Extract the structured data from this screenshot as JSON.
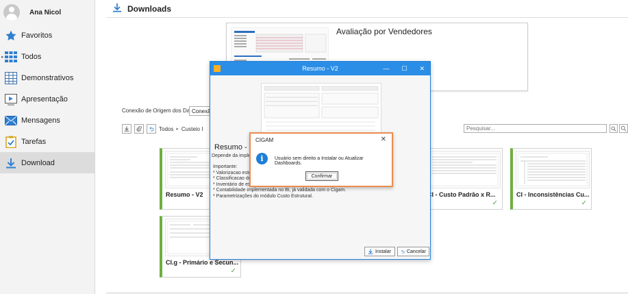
{
  "sidebar": {
    "user_name": "Ana Nicol",
    "items": [
      {
        "label": "Favoritos",
        "icon": "star-icon"
      },
      {
        "label": "Todos",
        "icon": "grid-icon"
      },
      {
        "label": "Demonstrativos",
        "icon": "table-icon"
      },
      {
        "label": "Apresentação",
        "icon": "presentation-icon"
      },
      {
        "label": "Mensagens",
        "icon": "mail-icon"
      },
      {
        "label": "Tarefas",
        "icon": "clipboard-icon"
      },
      {
        "label": "Download",
        "icon": "download-icon"
      }
    ]
  },
  "header": {
    "title": "Downloads"
  },
  "report_preview": {
    "title": "Avaliação por Vendedores"
  },
  "connection": {
    "label": "Conexão de Origem dos Dados",
    "value": "Conexão"
  },
  "toolbar": {
    "crumb_all": "Todos",
    "crumb_current": "Custeio I"
  },
  "search": {
    "placeholder": "Pesquisar..."
  },
  "cards": [
    {
      "title": "Resumo - V2"
    },
    {
      "title": "CI - Custo Padrão x R..."
    },
    {
      "title": "CI - Inconsistências Cu..."
    },
    {
      "title": "CI.g - Primário e Secun..."
    }
  ],
  "resumo_modal": {
    "title": "Resumo - V2",
    "heading": "Resumo - V",
    "dependency": "Depende da implem",
    "notes": [
      "Importante:",
      "* Valorizacao esto",
      "* Classificacao dos",
      "* Inventário de es",
      "* Contabilidade implementada no BI, já validada com o Cigam.",
      "* Parametrizações do módulo Custo Estrutural."
    ],
    "install_label": "Instalar",
    "cancel_label": "Cancelar"
  },
  "cigam_dialog": {
    "title": "CIGAM",
    "message": "Usuário sem direito a Instalar ou Atualizar Dashboards.",
    "confirm_label": "Confirmar"
  },
  "colors": {
    "accent": "#2b8ee6",
    "card_stripe": "#6fae3e",
    "dialog_border": "#e98d4f"
  }
}
